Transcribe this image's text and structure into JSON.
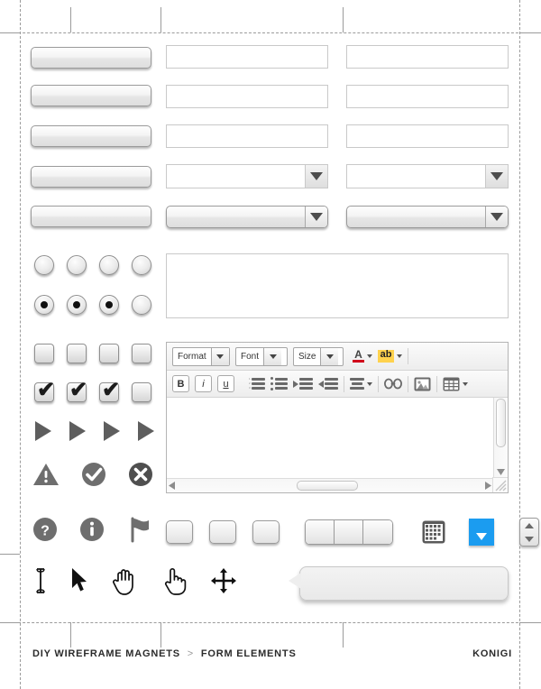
{
  "sheet": {
    "title": "DIY Wireframe Magnets — Form Elements",
    "footer": {
      "breadcrumb_root": "DIY WIREFRAME MAGNETS",
      "breadcrumb_separator": ">",
      "breadcrumb_current": "FORM ELEMENTS",
      "brand": "KONIGI"
    },
    "guides": {
      "color": "#9b9b9b",
      "style": "dashed"
    }
  },
  "buttons": {
    "count": 5,
    "labels": [
      "",
      "",
      "",
      "",
      ""
    ]
  },
  "text_fields": {
    "column_b_count": 3,
    "column_c_count": 3,
    "placeholder": "",
    "value": ""
  },
  "selects": {
    "flat": {
      "value": "",
      "arrow_icon": "chevron-down-icon"
    },
    "raised": {
      "value": "",
      "arrow_icon": "chevron-down-icon"
    }
  },
  "radios": {
    "row_unchecked": [
      false,
      false,
      false,
      false
    ],
    "row_checked": [
      true,
      true,
      true,
      false
    ]
  },
  "checkboxes": {
    "row_unchecked": [
      false,
      false,
      false,
      false
    ],
    "row_checked": [
      true,
      true,
      true,
      false
    ],
    "check_glyph": "✔"
  },
  "play_arrows": {
    "count": 4,
    "icon": "play-triangle-icon"
  },
  "status_icons": [
    {
      "name": "warning-icon",
      "glyph": "!"
    },
    {
      "name": "success-icon",
      "glyph": "✔"
    },
    {
      "name": "error-icon",
      "glyph": "✕"
    },
    {
      "name": "help-icon",
      "glyph": "?"
    },
    {
      "name": "info-icon",
      "glyph": "i"
    },
    {
      "name": "flag-icon",
      "glyph": "⚑"
    }
  ],
  "editor": {
    "toolbar_row1": {
      "format_dropdown": {
        "label": "Format",
        "icon": "chevron-down-icon"
      },
      "font_dropdown": {
        "label": "Font",
        "icon": "chevron-down-icon"
      },
      "size_dropdown": {
        "label": "Size",
        "icon": "chevron-down-icon"
      },
      "font_color": {
        "label": "A",
        "icon": "font-color-icon",
        "swatch": "#d0021b"
      },
      "highlight": {
        "label": "ab",
        "icon": "highlight-icon",
        "swatch": "#ffd24d"
      }
    },
    "toolbar_row2": {
      "bold": {
        "label": "B",
        "icon": "bold-icon"
      },
      "italic": {
        "label": "i",
        "icon": "italic-icon"
      },
      "underline": {
        "label": "u",
        "icon": "underline-icon"
      },
      "ordered_list": {
        "icon": "ordered-list-icon"
      },
      "unordered_list": {
        "icon": "unordered-list-icon"
      },
      "indent": {
        "icon": "indent-icon"
      },
      "outdent": {
        "icon": "outdent-icon"
      },
      "align": {
        "icon": "align-icon"
      },
      "link": {
        "icon": "link-icon"
      },
      "image": {
        "icon": "image-icon"
      },
      "table": {
        "icon": "table-icon"
      }
    },
    "content": "",
    "scrollbars": {
      "vertical": {
        "up_icon": "triangle-up-icon",
        "down_icon": "triangle-down-icon"
      },
      "horizontal": {
        "left_icon": "triangle-left-icon",
        "right_icon": "triangle-right-icon"
      },
      "resize_grip_icon": "resize-grip-icon"
    }
  },
  "textarea": {
    "value": "",
    "placeholder": ""
  },
  "widgets": {
    "square_buttons": 3,
    "segmented_control_segments": 3,
    "calendar": {
      "icon": "calendar-icon"
    },
    "blue_dropdown": {
      "icon": "triangle-down-icon",
      "color": "#1b9cf0"
    },
    "spinner": {
      "up_icon": "triangle-up-icon",
      "down_icon": "triangle-down-icon"
    },
    "drag_handle": {
      "icon": "drag-handle-icon"
    }
  },
  "cursors": [
    {
      "name": "text-cursor-icon",
      "label": "I-beam"
    },
    {
      "name": "arrow-cursor-icon",
      "label": "Arrow"
    },
    {
      "name": "grab-hand-icon",
      "label": "Open hand"
    },
    {
      "name": "pointer-hand-icon",
      "label": "Pointing hand"
    },
    {
      "name": "move-cursor-icon",
      "label": "Move"
    }
  ],
  "callout": {
    "text": ""
  }
}
